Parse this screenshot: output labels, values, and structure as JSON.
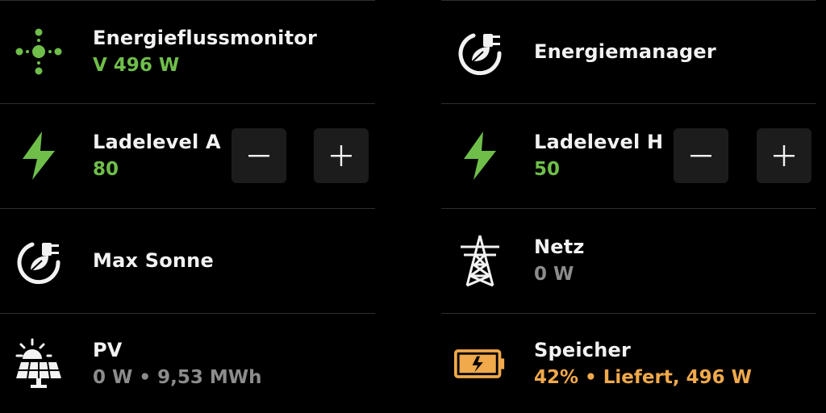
{
  "colors": {
    "accent_green": "#6fbe4a",
    "muted_gray": "#8c8c8c",
    "battery_amber": "#f0a94b",
    "icon_white": "#f2f2f2"
  },
  "left": [
    {
      "icon": "energy-flow-icon",
      "title": "Energieflussmonitor",
      "value": "V 496 W"
    },
    {
      "icon": "lightning-icon",
      "title": "Ladelevel A",
      "value": "80",
      "minus": "−",
      "plus": "+"
    },
    {
      "icon": "eco-plug-icon",
      "title": "Max Sonne"
    },
    {
      "icon": "solar-panel-icon",
      "title": "PV",
      "value": "0 W • 9,53 MWh"
    }
  ],
  "right": [
    {
      "icon": "eco-plug-icon",
      "title": "Energiemanager"
    },
    {
      "icon": "lightning-icon",
      "title": "Ladelevel H",
      "value": "50",
      "minus": "−",
      "plus": "+"
    },
    {
      "icon": "power-tower-icon",
      "title": "Netz",
      "value": "0 W"
    },
    {
      "icon": "battery-icon",
      "title": "Speicher",
      "value": "42% • Liefert, 496 W"
    }
  ]
}
